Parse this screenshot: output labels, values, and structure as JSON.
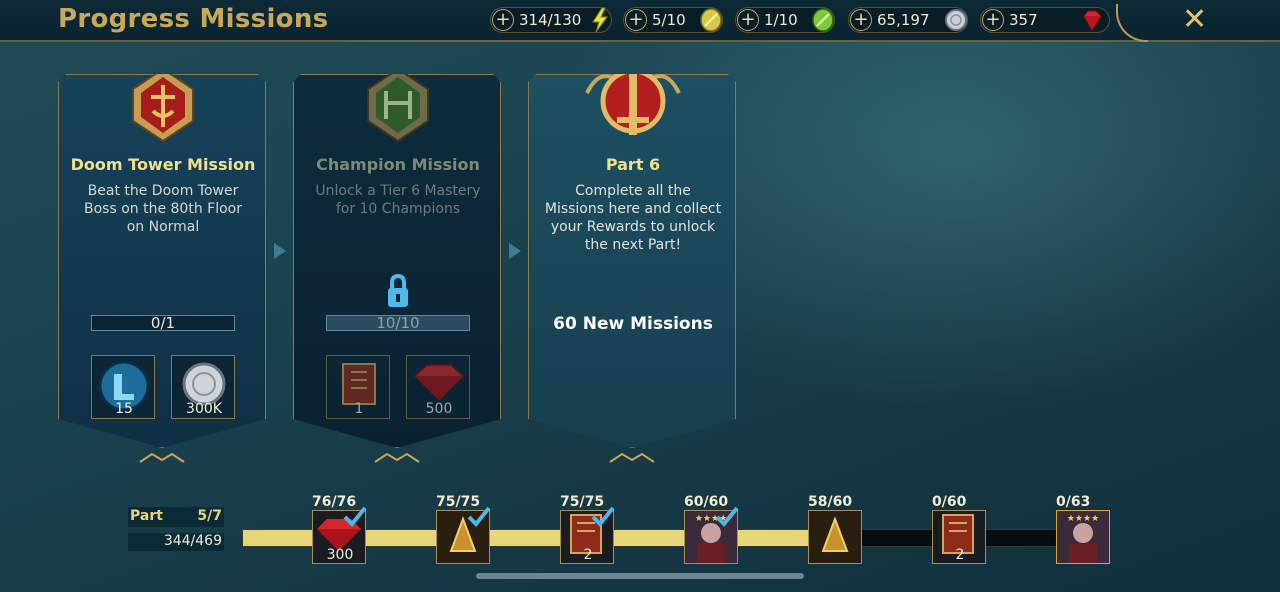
{
  "header": {
    "title": "Progress Missions",
    "close_label": "✕",
    "resources": [
      {
        "value": "314/130",
        "icon": "energy-bolt-icon"
      },
      {
        "value": "5/10",
        "icon": "gold-key-icon"
      },
      {
        "value": "1/10",
        "icon": "green-key-icon"
      },
      {
        "value": "65,197",
        "icon": "silver-coin-icon"
      },
      {
        "value": "357",
        "icon": "gem-icon"
      }
    ]
  },
  "cards": [
    {
      "title": "Doom Tower Mission",
      "desc_lines": [
        "Beat the Doom Tower",
        "Boss on the 80th Floor",
        "on Normal"
      ],
      "progress": "0/1",
      "rewards": [
        {
          "icon": "boots-icon",
          "qty": "15"
        },
        {
          "icon": "silver-coin-icon",
          "qty": "300K"
        }
      ]
    },
    {
      "title": "Champion Mission",
      "desc_lines": [
        "Unlock a Tier 6 Mastery",
        "for 10 Champions"
      ],
      "progress": "10/10",
      "rewards": [
        {
          "icon": "tome-icon",
          "qty": "1"
        },
        {
          "icon": "gem-icon",
          "qty": "500"
        }
      ]
    },
    {
      "title": "Part 6",
      "desc_lines": [
        "Complete all the",
        "Missions here and collect",
        "your Rewards to unlock",
        "the next Part!"
      ],
      "new_missions": "60 New Missions"
    }
  ],
  "part_progress": {
    "label": "Part",
    "part": "5/7",
    "points": "344/469",
    "fill_fraction": 0.733
  },
  "milestones": [
    {
      "label": "76/76",
      "qty": "300",
      "icon": "gem-icon",
      "claimed": true
    },
    {
      "label": "75/75",
      "qty": "",
      "icon": "champion-helmet-icon",
      "claimed": true
    },
    {
      "label": "75/75",
      "qty": "2",
      "icon": "tome-icon",
      "claimed": true
    },
    {
      "label": "60/60",
      "qty": "",
      "icon": "champion-portrait-icon",
      "claimed": true
    },
    {
      "label": "58/60",
      "qty": "",
      "icon": "champion-helmet-icon",
      "claimed": false
    },
    {
      "label": "0/60",
      "qty": "2",
      "icon": "tome-icon",
      "claimed": false
    },
    {
      "label": "0/63",
      "qty": "",
      "icon": "champion-portrait-icon",
      "claimed": false
    }
  ],
  "colors": {
    "accent_gold": "#c9a85c",
    "progress_fill": "#e8d479",
    "check_blue": "#4fb6e6"
  }
}
